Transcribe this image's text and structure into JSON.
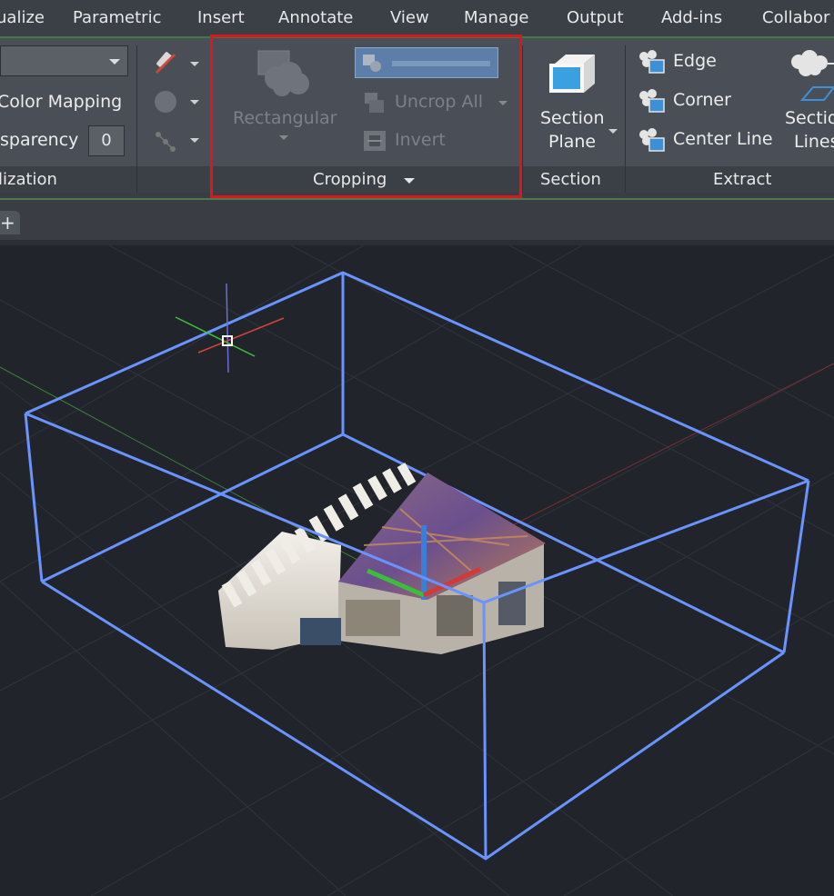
{
  "menu": {
    "items": [
      "ualize",
      "Parametric",
      "Insert",
      "Annotate",
      "View",
      "Manage",
      "Output",
      "Add-ins",
      "Collabor"
    ]
  },
  "ribbon": {
    "visualization": {
      "color_mapping": "Color Mapping",
      "transparency_label": "sparency",
      "transparency_value": "0",
      "panel_label": "lization"
    },
    "cropping": {
      "rectangular": "Rectangular",
      "uncrop_all": "Uncrop All",
      "invert": "Invert",
      "panel_label": "Cropping"
    },
    "section": {
      "section_plane_line1": "Section",
      "section_plane_line2": "Plane",
      "panel_label": "Section"
    },
    "extract": {
      "edge": "Edge",
      "corner": "Corner",
      "center_line": "Center Line",
      "section_lines_line1": "Sectio",
      "section_lines_line2": "Lines",
      "panel_label": "Extract"
    }
  },
  "tabs": {
    "new_tab": "+"
  },
  "colors": {
    "menubar_bg": "#3b3f46",
    "ribbon_bg": "#4a4e56",
    "viewport_bg": "#21252b",
    "crop_box": "#6a93ff",
    "highlight_border": "#e0141b"
  }
}
